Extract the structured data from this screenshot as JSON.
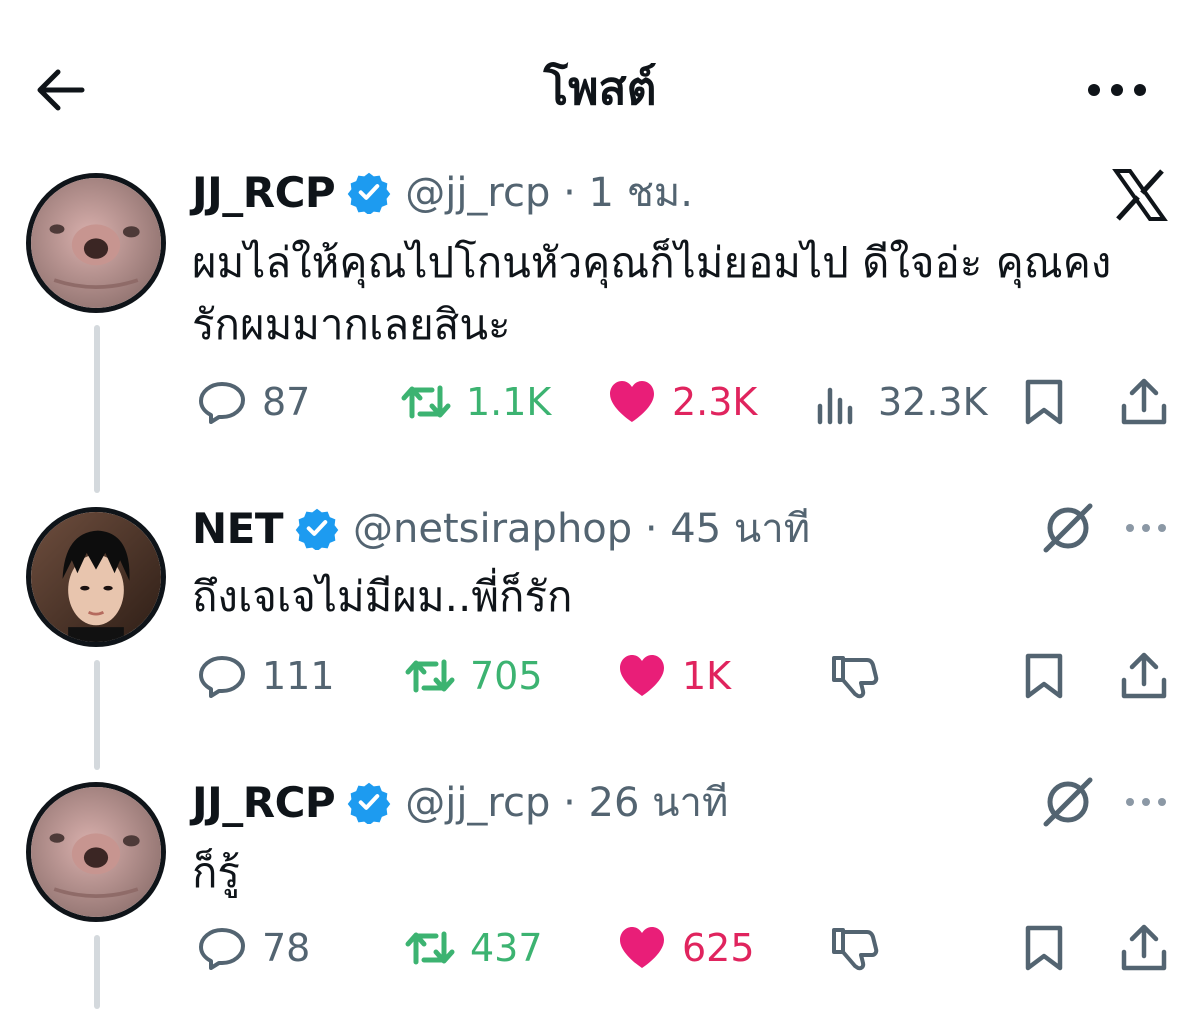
{
  "header": {
    "title": "โพสต์"
  },
  "posts": [
    {
      "name": "JJ_RCP",
      "meta": "@jj_rcp · 1 ชม.",
      "text": "ผมไล่ให้คุณไปโกนหัวคุณก็ไม่ยอมไป ดีใจอ่ะ คุณคงรักผมมากเลยสินะ",
      "reply_count": "87",
      "repost_count": "1.1K",
      "like_count": "2.3K",
      "view_count": "32.3K"
    },
    {
      "name": "NET",
      "meta": "@netsiraphop · 45 นาที",
      "text": "ถึงเจเจไม่มีผม..พี่ก็รัก",
      "reply_count": "111",
      "repost_count": "705",
      "like_count": "1K"
    },
    {
      "name": "JJ_RCP",
      "meta": "@jj_rcp · 26 นาที",
      "text": "ก็รู้",
      "reply_count": "78",
      "repost_count": "437",
      "like_count": "625"
    }
  ],
  "colors": {
    "text": "#0f1419",
    "muted": "#536471",
    "verified": "#1d9bf0",
    "repost": "#3cb371",
    "like": "#e0245e"
  },
  "icons": [
    "back-arrow-icon",
    "more-icon",
    "verified-icon",
    "reply-icon",
    "repost-icon",
    "heart-icon",
    "views-icon",
    "bookmark-icon",
    "share-icon",
    "x-logo-icon",
    "grok-icon",
    "dislike-icon"
  ]
}
